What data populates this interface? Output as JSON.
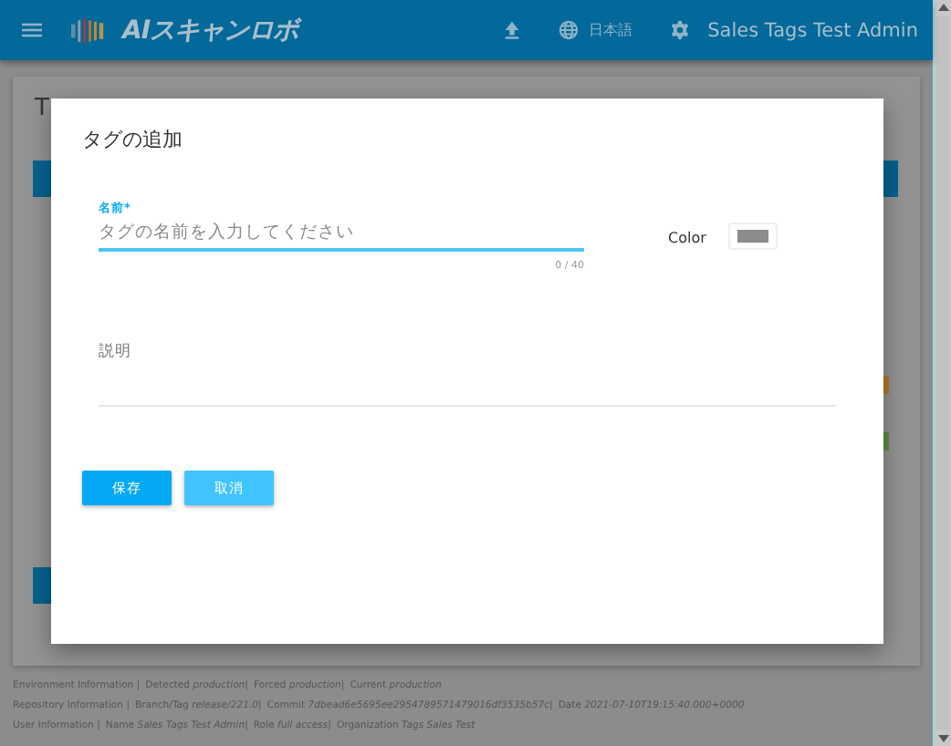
{
  "app_bar": {
    "logo_text": "AIスキャンロボ",
    "language": "日本語",
    "user": "Sales Tags Test Admin"
  },
  "background_page": {
    "heading": "T"
  },
  "dialog": {
    "title": "タグの追加",
    "name_field": {
      "label": "名前",
      "required_mark": "*",
      "placeholder": "タグの名前を入力してください",
      "counter": "0 / 40",
      "focused": true
    },
    "color_field": {
      "label": "Color",
      "color": "#8c8c8c"
    },
    "description_field": {
      "label": "説明"
    },
    "buttons": [
      {
        "label": "保存",
        "kind": "primary"
      },
      {
        "label": "取消",
        "kind": "secondary"
      }
    ]
  },
  "footer": [
    {
      "title": "Environment Information |",
      "items": [
        {
          "label": "Detected",
          "value": "production",
          "separator": "|"
        },
        {
          "label": "Forced",
          "value": "production",
          "separator": "|"
        },
        {
          "label": "Current",
          "value": "production"
        }
      ]
    },
    {
      "title": "Repository Information |",
      "items": [
        {
          "label": "Branch/Tag",
          "value": "release/221.0",
          "separator": "|"
        },
        {
          "label": "Commit",
          "value": "7dbead6e5695ee2954789571479016df3535b57c",
          "separator": "|"
        },
        {
          "label": "Date",
          "value": "2021-07-10T19:15:40.000+0000"
        }
      ]
    },
    {
      "title": "User Information |",
      "items": [
        {
          "label": "Name",
          "value": "Sales Tags Test Admin",
          "separator": "|"
        },
        {
          "label": "Role",
          "value": "full access",
          "separator": "|"
        },
        {
          "label": "Organization",
          "value": "Tags Sales Test"
        }
      ]
    }
  ]
}
